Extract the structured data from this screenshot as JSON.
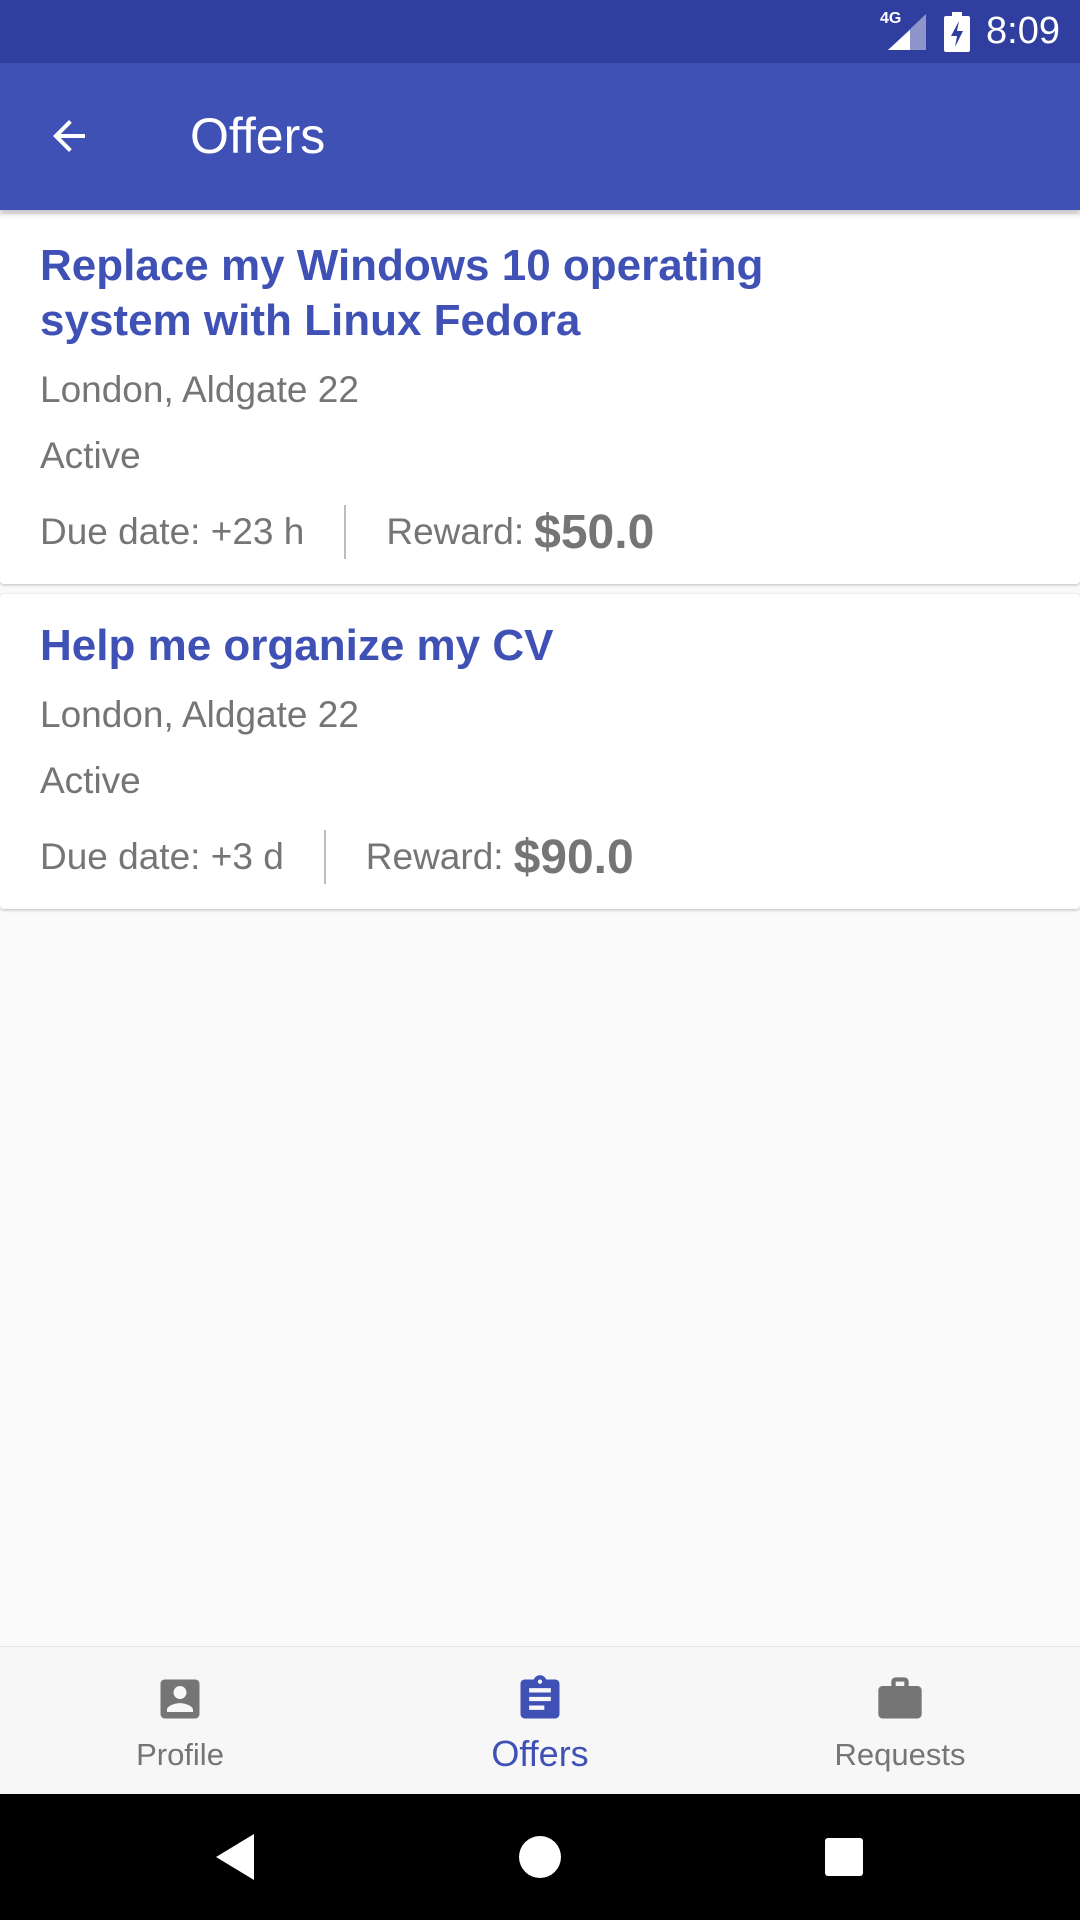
{
  "status_bar": {
    "network": "4G",
    "time": "8:09"
  },
  "app_bar": {
    "title": "Offers",
    "back_icon": "arrow-back-icon"
  },
  "offers": [
    {
      "title": "Replace my Windows 10 operating system with Linux Fedora",
      "location": "London, Aldgate 22",
      "status": "Active",
      "due_date": "Due date: +23 h",
      "reward_label": "Reward:",
      "reward_amount": "$50.0"
    },
    {
      "title": "Help me organize my CV",
      "location": "London, Aldgate 22",
      "status": "Active",
      "due_date": "Due date: +3 d",
      "reward_label": "Reward:",
      "reward_amount": "$90.0"
    }
  ],
  "bottom_nav": {
    "items": [
      {
        "label": "Profile",
        "icon": "account-box-icon",
        "active": false
      },
      {
        "label": "Offers",
        "icon": "clipboard-icon",
        "active": true
      },
      {
        "label": "Requests",
        "icon": "briefcase-icon",
        "active": false
      }
    ]
  },
  "colors": {
    "status_bar": "#303f9f",
    "primary": "#3f51b5",
    "text_secondary": "#757575",
    "background": "#fafafa"
  }
}
